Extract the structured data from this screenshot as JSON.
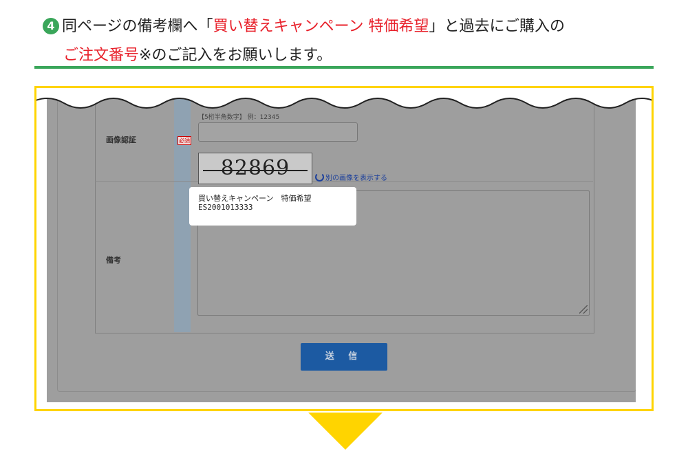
{
  "instruction": {
    "step_number": "4",
    "text_1": "同ページの備考欄へ「",
    "text_red_1": "買い替えキャンペーン 特価希望",
    "text_2": "」と過去にご購入の",
    "text_red_2": "ご注文番号",
    "text_3": "※のご記入をお願いします。"
  },
  "form": {
    "captcha_label": "画像認証",
    "required_badge": "必須",
    "captcha_hint": "【5桁半角数字】 例：12345",
    "captcha_code": "82869",
    "refresh_link": "別の画像を表示する",
    "remarks_label": "備考",
    "remarks_line_1": "買い替えキャンペーン　特価希望",
    "remarks_line_2": "ES2001013333",
    "submit_label": "送 信"
  },
  "colors": {
    "accent_green": "#3aa65a",
    "highlight_red": "#e8212b",
    "frame_yellow": "#ffd400",
    "submit_blue": "#1c5aa2"
  }
}
